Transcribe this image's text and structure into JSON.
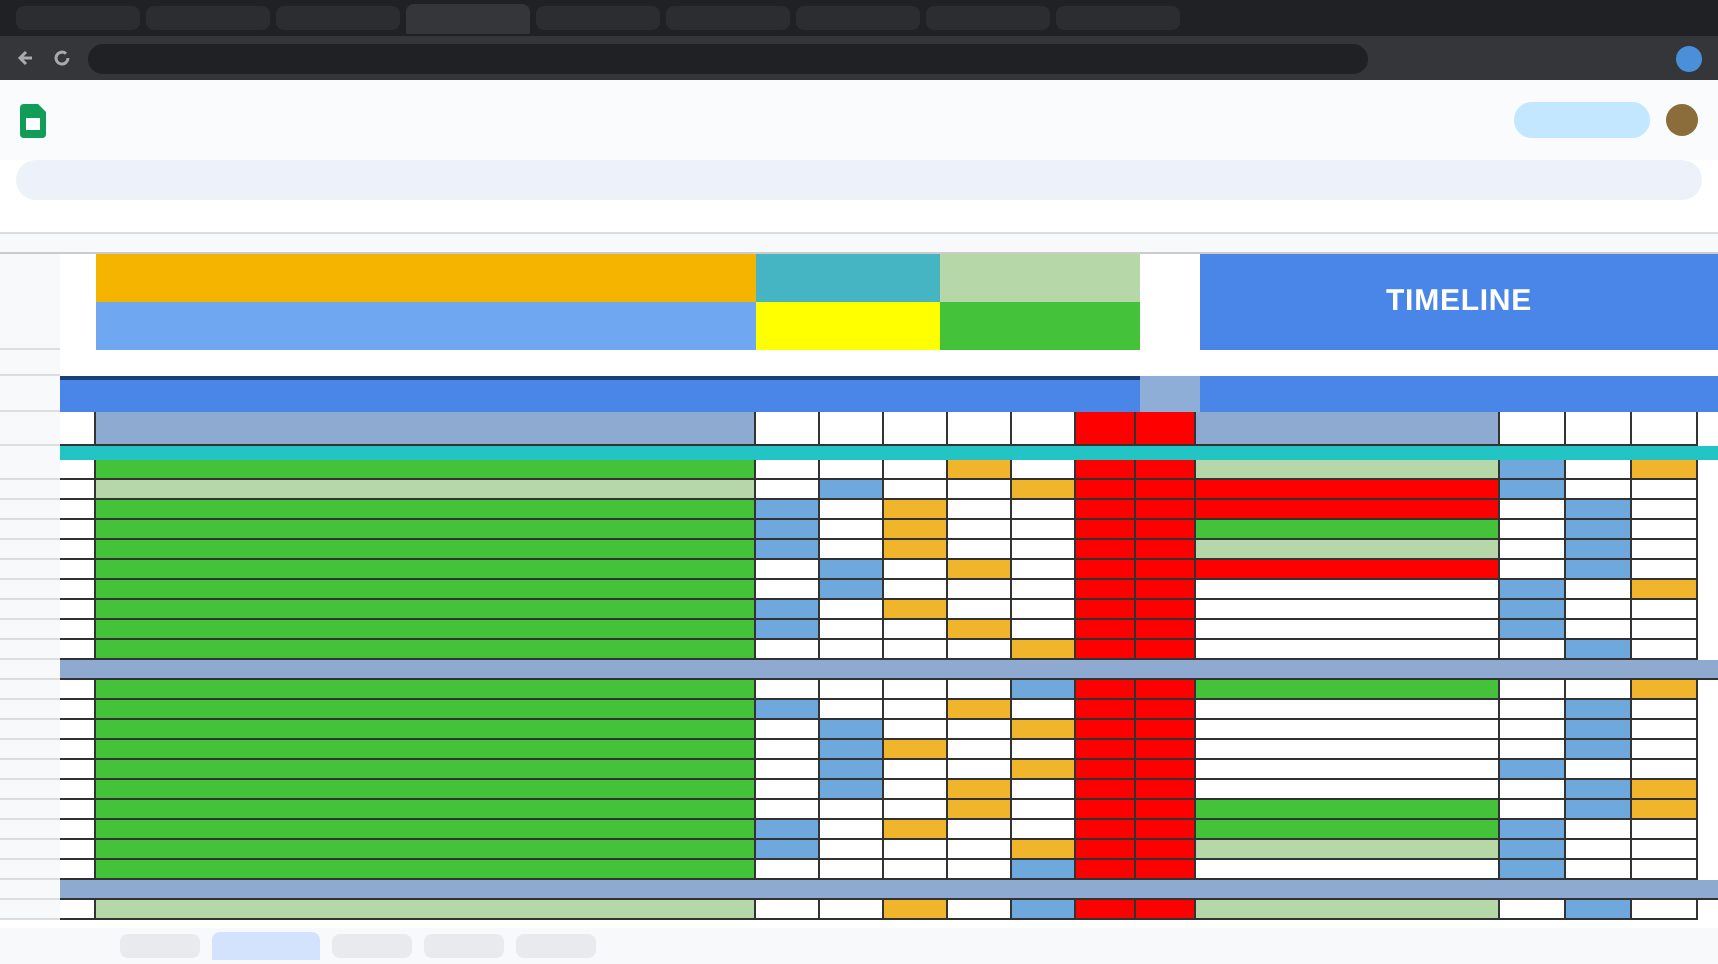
{
  "browser_tabs": [
    {
      "selected": false
    },
    {
      "selected": false
    },
    {
      "selected": false
    },
    {
      "selected": true
    },
    {
      "selected": false
    },
    {
      "selected": false
    },
    {
      "selected": false
    },
    {
      "selected": false
    },
    {
      "selected": false
    }
  ],
  "timeline": {
    "title": "TIMELINE"
  },
  "rows": [
    {
      "kind": "task",
      "color": "#44c23a",
      "days": [
        {
          "kind": "empty"
        },
        {
          "kind": "empty"
        },
        {
          "kind": "empty"
        },
        {
          "kind": "done"
        },
        {
          "kind": "empty"
        }
      ],
      "timeline": {
        "color": "#b6d7a8",
        "days": [
          {
            "kind": "planned"
          },
          {
            "kind": "empty"
          },
          {
            "kind": "done"
          }
        ]
      }
    },
    {
      "kind": "task",
      "color": "#b6d7a8",
      "days": [
        {
          "kind": "empty"
        },
        {
          "kind": "planned"
        },
        {
          "kind": "empty"
        },
        {
          "kind": "empty"
        },
        {
          "kind": "done"
        }
      ],
      "timeline": {
        "color": "#ff0000",
        "days": [
          {
            "kind": "planned"
          },
          {
            "kind": "empty"
          },
          {
            "kind": "empty"
          }
        ]
      }
    },
    {
      "kind": "task",
      "color": "#44c23a",
      "days": [
        {
          "kind": "planned"
        },
        {
          "kind": "empty"
        },
        {
          "kind": "done"
        },
        {
          "kind": "empty"
        },
        {
          "kind": "empty"
        }
      ],
      "timeline": {
        "color": "#ff0000",
        "days": [
          {
            "kind": "empty"
          },
          {
            "kind": "planned"
          },
          {
            "kind": "empty"
          }
        ]
      }
    },
    {
      "kind": "task",
      "color": "#44c23a",
      "days": [
        {
          "kind": "planned"
        },
        {
          "kind": "empty"
        },
        {
          "kind": "done"
        },
        {
          "kind": "empty"
        },
        {
          "kind": "empty"
        }
      ],
      "timeline": {
        "color": "#44c23a",
        "days": [
          {
            "kind": "empty"
          },
          {
            "kind": "planned"
          },
          {
            "kind": "empty"
          }
        ]
      }
    },
    {
      "kind": "task",
      "color": "#44c23a",
      "days": [
        {
          "kind": "planned"
        },
        {
          "kind": "empty"
        },
        {
          "kind": "done"
        },
        {
          "kind": "empty"
        },
        {
          "kind": "empty"
        }
      ],
      "timeline": {
        "color": "#b6d7a8",
        "days": [
          {
            "kind": "empty"
          },
          {
            "kind": "planned"
          },
          {
            "kind": "empty"
          }
        ]
      }
    },
    {
      "kind": "task",
      "color": "#44c23a",
      "days": [
        {
          "kind": "empty"
        },
        {
          "kind": "planned"
        },
        {
          "kind": "empty"
        },
        {
          "kind": "done"
        },
        {
          "kind": "empty"
        }
      ],
      "timeline": {
        "color": "#ff0000",
        "days": [
          {
            "kind": "empty"
          },
          {
            "kind": "planned"
          },
          {
            "kind": "empty"
          }
        ]
      }
    },
    {
      "kind": "task",
      "color": "#44c23a",
      "days": [
        {
          "kind": "empty"
        },
        {
          "kind": "planned"
        },
        {
          "kind": "empty"
        },
        {
          "kind": "empty"
        },
        {
          "kind": "empty"
        }
      ],
      "timeline": {
        "color": "#ffffff",
        "days": [
          {
            "kind": "planned"
          },
          {
            "kind": "empty"
          },
          {
            "kind": "done"
          }
        ]
      }
    },
    {
      "kind": "task",
      "color": "#44c23a",
      "days": [
        {
          "kind": "planned"
        },
        {
          "kind": "empty"
        },
        {
          "kind": "done"
        },
        {
          "kind": "empty"
        },
        {
          "kind": "empty"
        }
      ],
      "timeline": {
        "color": "#ffffff",
        "days": [
          {
            "kind": "planned"
          },
          {
            "kind": "empty"
          },
          {
            "kind": "empty"
          }
        ]
      }
    },
    {
      "kind": "task",
      "color": "#44c23a",
      "days": [
        {
          "kind": "planned"
        },
        {
          "kind": "empty"
        },
        {
          "kind": "empty"
        },
        {
          "kind": "done"
        },
        {
          "kind": "empty"
        }
      ],
      "timeline": {
        "color": "#ffffff",
        "days": [
          {
            "kind": "planned"
          },
          {
            "kind": "empty"
          },
          {
            "kind": "empty"
          }
        ]
      }
    },
    {
      "kind": "task",
      "color": "#44c23a",
      "days": [
        {
          "kind": "empty"
        },
        {
          "kind": "empty"
        },
        {
          "kind": "empty"
        },
        {
          "kind": "empty"
        },
        {
          "kind": "done"
        }
      ],
      "timeline": {
        "color": "#ffffff",
        "days": [
          {
            "kind": "empty"
          },
          {
            "kind": "planned"
          },
          {
            "kind": "empty"
          }
        ]
      }
    },
    {
      "kind": "section"
    },
    {
      "kind": "task",
      "color": "#44c23a",
      "days": [
        {
          "kind": "empty"
        },
        {
          "kind": "empty"
        },
        {
          "kind": "empty"
        },
        {
          "kind": "empty"
        },
        {
          "kind": "planned"
        }
      ],
      "timeline": {
        "color": "#44c23a",
        "days": [
          {
            "kind": "empty"
          },
          {
            "kind": "empty"
          },
          {
            "kind": "done"
          }
        ]
      }
    },
    {
      "kind": "task",
      "color": "#44c23a",
      "days": [
        {
          "kind": "planned"
        },
        {
          "kind": "empty"
        },
        {
          "kind": "empty"
        },
        {
          "kind": "done"
        },
        {
          "kind": "empty"
        }
      ],
      "timeline": {
        "color": "#ffffff",
        "days": [
          {
            "kind": "empty"
          },
          {
            "kind": "planned"
          },
          {
            "kind": "empty"
          }
        ]
      }
    },
    {
      "kind": "task",
      "color": "#44c23a",
      "days": [
        {
          "kind": "empty"
        },
        {
          "kind": "planned"
        },
        {
          "kind": "empty"
        },
        {
          "kind": "empty"
        },
        {
          "kind": "done"
        }
      ],
      "timeline": {
        "color": "#ffffff",
        "days": [
          {
            "kind": "empty"
          },
          {
            "kind": "planned"
          },
          {
            "kind": "empty"
          }
        ]
      }
    },
    {
      "kind": "task",
      "color": "#44c23a",
      "days": [
        {
          "kind": "empty"
        },
        {
          "kind": "planned"
        },
        {
          "kind": "done"
        },
        {
          "kind": "empty"
        },
        {
          "kind": "empty"
        }
      ],
      "timeline": {
        "color": "#ffffff",
        "days": [
          {
            "kind": "empty"
          },
          {
            "kind": "planned"
          },
          {
            "kind": "empty"
          }
        ]
      }
    },
    {
      "kind": "task",
      "color": "#44c23a",
      "days": [
        {
          "kind": "empty"
        },
        {
          "kind": "planned"
        },
        {
          "kind": "empty"
        },
        {
          "kind": "empty"
        },
        {
          "kind": "done"
        }
      ],
      "timeline": {
        "color": "#ffffff",
        "days": [
          {
            "kind": "planned"
          },
          {
            "kind": "empty"
          },
          {
            "kind": "empty"
          }
        ]
      }
    },
    {
      "kind": "task",
      "color": "#44c23a",
      "days": [
        {
          "kind": "empty"
        },
        {
          "kind": "planned"
        },
        {
          "kind": "empty"
        },
        {
          "kind": "done"
        },
        {
          "kind": "empty"
        }
      ],
      "timeline": {
        "color": "#ffffff",
        "days": [
          {
            "kind": "empty"
          },
          {
            "kind": "planned"
          },
          {
            "kind": "done"
          }
        ]
      }
    },
    {
      "kind": "task",
      "color": "#44c23a",
      "days": [
        {
          "kind": "empty"
        },
        {
          "kind": "empty"
        },
        {
          "kind": "empty"
        },
        {
          "kind": "done"
        },
        {
          "kind": "empty"
        }
      ],
      "timeline": {
        "color": "#44c23a",
        "days": [
          {
            "kind": "empty"
          },
          {
            "kind": "planned"
          },
          {
            "kind": "done"
          }
        ]
      }
    },
    {
      "kind": "task",
      "color": "#44c23a",
      "days": [
        {
          "kind": "planned"
        },
        {
          "kind": "empty"
        },
        {
          "kind": "done"
        },
        {
          "kind": "empty"
        },
        {
          "kind": "empty"
        }
      ],
      "timeline": {
        "color": "#44c23a",
        "days": [
          {
            "kind": "planned"
          },
          {
            "kind": "empty"
          },
          {
            "kind": "empty"
          }
        ]
      }
    },
    {
      "kind": "task",
      "color": "#44c23a",
      "days": [
        {
          "kind": "planned"
        },
        {
          "kind": "empty"
        },
        {
          "kind": "empty"
        },
        {
          "kind": "empty"
        },
        {
          "kind": "done"
        }
      ],
      "timeline": {
        "color": "#b6d7a8",
        "days": [
          {
            "kind": "planned"
          },
          {
            "kind": "empty"
          },
          {
            "kind": "empty"
          }
        ]
      }
    },
    {
      "kind": "task",
      "color": "#44c23a",
      "days": [
        {
          "kind": "empty"
        },
        {
          "kind": "empty"
        },
        {
          "kind": "empty"
        },
        {
          "kind": "empty"
        },
        {
          "kind": "planned"
        }
      ],
      "timeline": {
        "color": "#ffffff",
        "days": [
          {
            "kind": "planned"
          },
          {
            "kind": "empty"
          },
          {
            "kind": "empty"
          }
        ]
      }
    },
    {
      "kind": "section"
    },
    {
      "kind": "task",
      "color": "#b6d7a8",
      "days": [
        {
          "kind": "empty"
        },
        {
          "kind": "empty"
        },
        {
          "kind": "done"
        },
        {
          "kind": "empty"
        },
        {
          "kind": "planned"
        }
      ],
      "timeline": {
        "color": "#b6d7a8",
        "days": [
          {
            "kind": "empty"
          },
          {
            "kind": "planned"
          },
          {
            "kind": "empty"
          }
        ]
      }
    }
  ],
  "sheet_tabs": [
    {
      "selected": false
    },
    {
      "selected": true
    },
    {
      "selected": false
    },
    {
      "selected": false
    },
    {
      "selected": false
    }
  ]
}
